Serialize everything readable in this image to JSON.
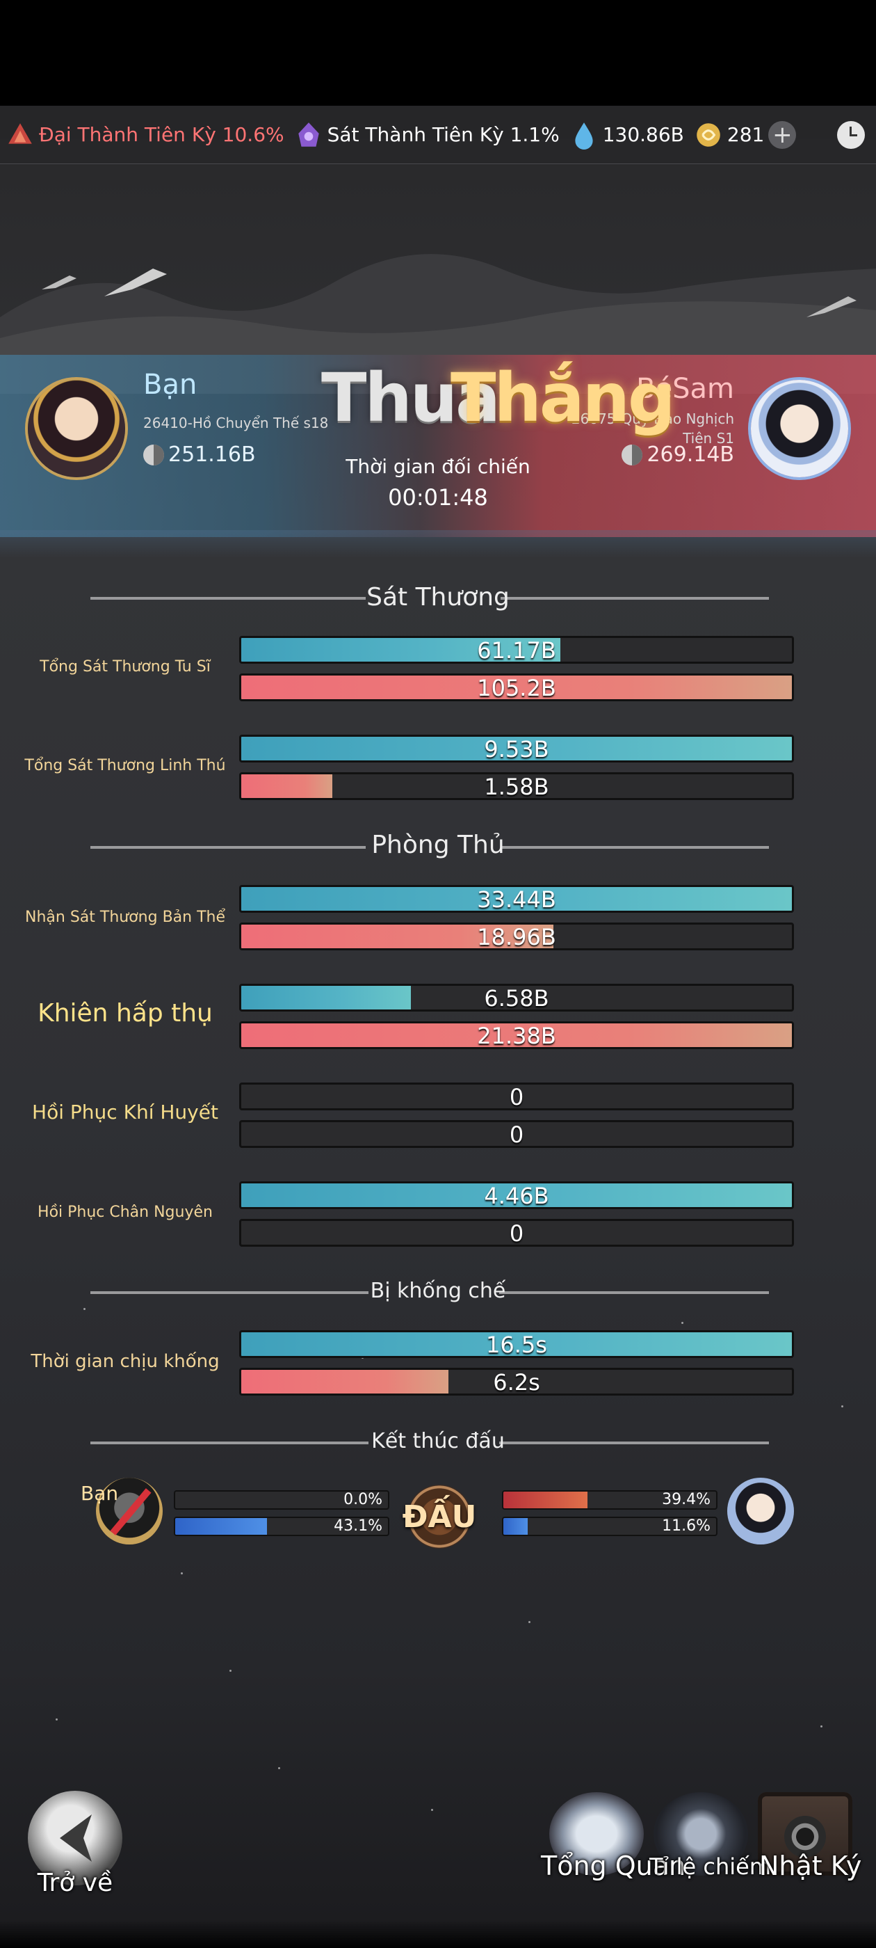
{
  "topbar": {
    "realm_player": "Đại Thành Tiên Kỳ 10.6%",
    "realm_opponent": "Sát Thành Tiên Kỳ 1.1%",
    "spirit_stones": "130.86B",
    "currency": "281",
    "plus_icon": "+",
    "icons": [
      "fire-realm-icon",
      "purple-realm-icon",
      "water-drop-icon",
      "gold-coin-icon",
      "plus-icon",
      "clock-icon"
    ]
  },
  "player": {
    "name": "Bạn",
    "server": "26410-Hồ Chuyển Thế s18",
    "power": "251.16B"
  },
  "opponent": {
    "name": "BéSam",
    "server": "26675-Quỷ Đạo Nghịch Tiên S1",
    "power": "269.14B"
  },
  "result": {
    "left": "Thua",
    "right": "Thắng",
    "time_label": "Thời gian đối chiến",
    "time": "00:01:48"
  },
  "sections": {
    "damage": "Sát Thương",
    "defense": "Phòng Thủ",
    "control": "Bị khống chế",
    "end": "Kết thúc đấu"
  },
  "stats": [
    {
      "label": "Tổng Sát Thương Tu Sĩ",
      "player": "61.17B",
      "player_fill": 0.58,
      "opponent": "105.2B",
      "opponent_fill": 1.0
    },
    {
      "label": "Tổng Sát Thương Linh Thú",
      "player": "9.53B",
      "player_fill": 1.0,
      "opponent": "1.58B",
      "opponent_fill": 0.166
    },
    {
      "label": "Nhận Sát Thương Bản Thể",
      "player": "33.44B",
      "player_fill": 1.0,
      "opponent": "18.96B",
      "opponent_fill": 0.567
    },
    {
      "label": "Khiên hấp thụ",
      "player": "6.58B",
      "player_fill": 0.308,
      "opponent": "21.38B",
      "opponent_fill": 1.0
    },
    {
      "label": "Hồi Phục Khí Huyết",
      "player": "0",
      "player_fill": 0,
      "opponent": "0",
      "opponent_fill": 0
    },
    {
      "label": "Hồi Phục Chân Nguyên",
      "player": "4.46B",
      "player_fill": 1.0,
      "opponent": "0",
      "opponent_fill": 0
    },
    {
      "label": "Thời gian chịu khống",
      "player": "16.5s",
      "player_fill": 1.0,
      "opponent": "6.2s",
      "opponent_fill": 0.376
    }
  ],
  "end_battle": {
    "player_tag": "Bạn",
    "vs": "ĐẤU",
    "player_bars": [
      {
        "value": "0.0%",
        "fill": 0.0
      },
      {
        "value": "43.1%",
        "fill": 0.431
      }
    ],
    "opponent_bars": [
      {
        "value": "39.4%",
        "fill": 0.394
      },
      {
        "value": "11.6%",
        "fill": 0.116
      }
    ]
  },
  "footer": {
    "back": "Trở về",
    "overview": "Tổng Quan",
    "ratio": "Tỉ lệ chiếm",
    "log": "Nhật Ký"
  }
}
